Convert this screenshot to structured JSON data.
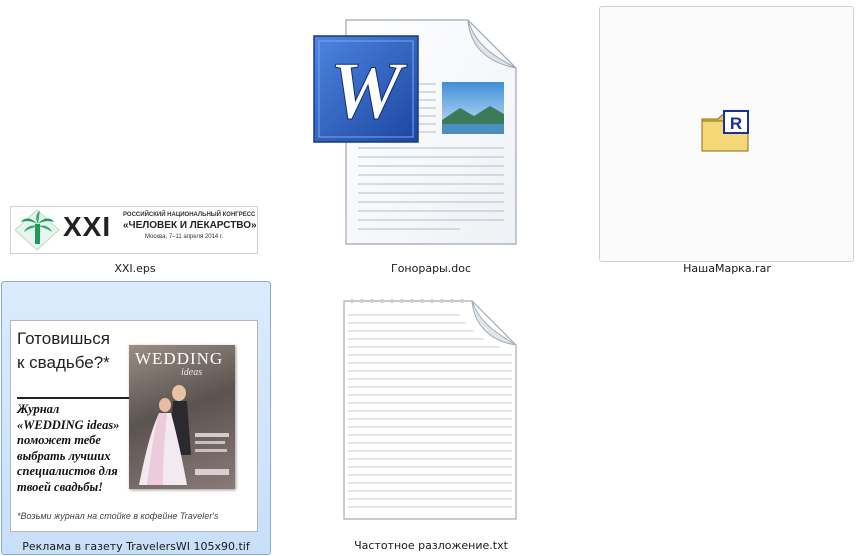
{
  "files": [
    {
      "name": "XXI.eps",
      "thumbnail": {
        "big_text": "XXI",
        "line1": "РОССИЙСКИЙ НАЦИОНАЛЬНЫЙ КОНГРЕСС",
        "line2": "«ЧЕЛОВЕК И ЛЕКАРСТВО»",
        "line3": "Москва, 7–11 апреля 2014 г."
      }
    },
    {
      "name": "Гонорары.doc",
      "icon": "word-document-icon"
    },
    {
      "name": "НашаМарка.rar",
      "icon": "winrar-archive-icon"
    },
    {
      "name": "Реклама в газету TravelersWI 105x90.tif",
      "selected": true,
      "thumbnail": {
        "headline1": "Готовишься",
        "headline2": "к свадьбе?*",
        "body": [
          "Журнал",
          "«WEDDING ideas»",
          "поможет тебе",
          "выбрать лучших",
          "специалистов для",
          "твоей свадьбы!"
        ],
        "footnote": "*Возьми журнал на стойке в кофейне Traveler's",
        "magazine_title": "WEDDING",
        "magazine_subtitle": "ideas"
      }
    },
    {
      "name": "Частотное разложение.txt",
      "icon": "text-document-icon"
    }
  ],
  "colors": {
    "selection_bg": "#cce0f7",
    "selection_border": "#84acdd",
    "word_blue": "#2b5cb8",
    "logo_green": "#1f9a5c"
  }
}
